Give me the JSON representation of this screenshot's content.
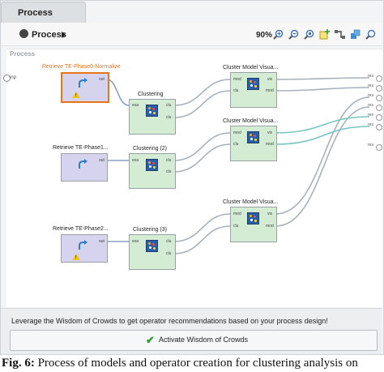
{
  "tab": {
    "title": "Process"
  },
  "toolbar": {
    "process_label": "Process",
    "zoom": "90%",
    "icons": [
      "zoom-in-icon",
      "zoom-out-icon",
      "zoom-fit-icon",
      "zoom-reset-icon",
      "add-note-icon",
      "auto-wire-icon",
      "layout-icon",
      "more-icon"
    ]
  },
  "canvas": {
    "label": "Process",
    "input_port": "inp",
    "operators": {
      "retrieve0": {
        "title": "Retrieve TE-Phase0-Normalize",
        "out": "out"
      },
      "retrieve1": {
        "title": "Retrieve TE-Phase1...",
        "out": "out"
      },
      "retrieve2": {
        "title": "Retrieve TE-Phase2...",
        "out": "out"
      },
      "cluster0": {
        "title": "Clustering",
        "in": "exa",
        "out1": "clu",
        "out2": "clu"
      },
      "cluster1": {
        "title": "Clustering (2)",
        "in": "exa",
        "out1": "clu",
        "out2": "clu"
      },
      "cluster2": {
        "title": "Clustering (3)",
        "in": "exa",
        "out1": "clu",
        "out2": "clu"
      },
      "visual0": {
        "title": "Cluster Model Visua...",
        "in1": "mod",
        "in2": "clu",
        "out1": "vis",
        "out2": "mod"
      },
      "visual1": {
        "title": "Cluster Model Visua...",
        "in1": "mod",
        "in2": "clu",
        "out1": "vis",
        "out2": "mod"
      },
      "visual2": {
        "title": "Cluster Model Visua...",
        "in1": "mod",
        "in2": "clu",
        "out1": "vis",
        "out2": "mod"
      }
    },
    "result_ports": [
      "res",
      "res",
      "res",
      "res",
      "res",
      "res",
      "res"
    ]
  },
  "footer": {
    "hint": "Leverage the Wisdom of Crowds to get operator recommendations based on your process design!",
    "button_label": "Activate Wisdom of Crowds"
  },
  "caption": {
    "label": "Fig. 6:",
    "text": " Process of models and operator creation for clustering analysis on"
  },
  "colors": {
    "retrieve_bg": "#d6d3ee",
    "cluster_bg": "#d3ecd3",
    "warning": "#f0c419",
    "title_orange": "#e8741c",
    "accept": "#2e9a3a"
  }
}
